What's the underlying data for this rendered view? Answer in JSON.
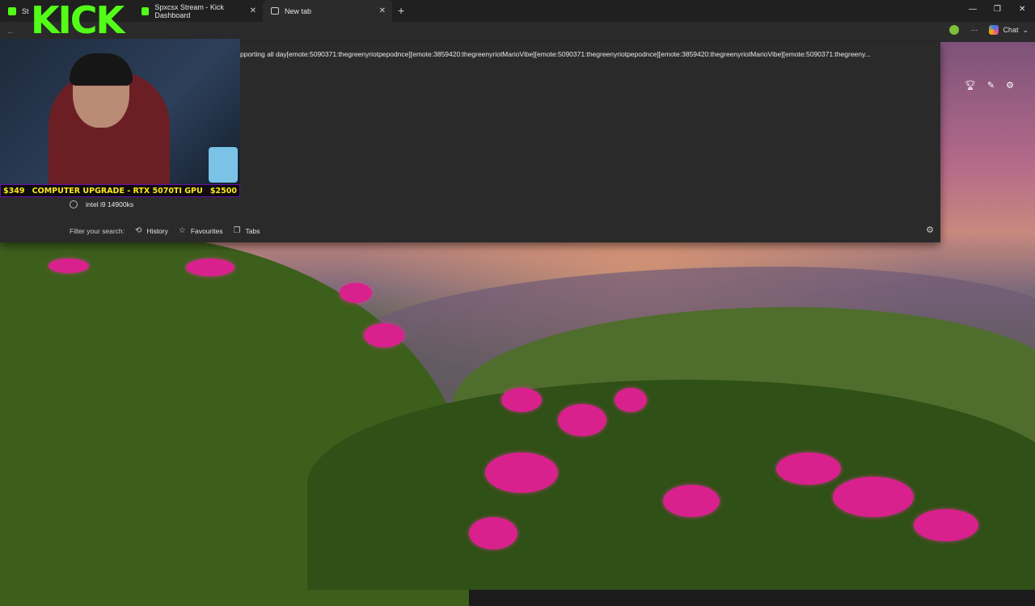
{
  "tabs": [
    {
      "title": "St",
      "active": false
    },
    {
      "title": "Spxcsx Stream - Kick Dashboard",
      "active": false
    },
    {
      "title": "New tab",
      "active": true
    }
  ],
  "window_controls": {
    "minimize": "—",
    "restore": "❐",
    "close": "✕"
  },
  "toolbar": {
    "chat_label": "Chat",
    "more_label": "···"
  },
  "omnibox": {
    "query_text": "pporting all day[emote:5090371:thegreenyriotpepodnce][emote:3859420:thegreenyriotMarioVibe][emote:5090371:thegreenyriotpepodnce][emote:3859420:thegreenyriotMarioVibe][emote:5090371:thegreeny...",
    "suggestion": "intel i9 14900ks",
    "filter_label": "Filter your search:",
    "filters": [
      "History",
      "Favourites",
      "Tabs"
    ]
  },
  "stream_overlay": {
    "logo": "KICK",
    "goal_current": "$349",
    "goal_label": "COMPUTER UPGRADE - RTX 5070TI GPU",
    "goal_target": "$2500"
  },
  "colors": {
    "kick_green": "#53fc18",
    "goal_yellow": "#ffe81a"
  }
}
